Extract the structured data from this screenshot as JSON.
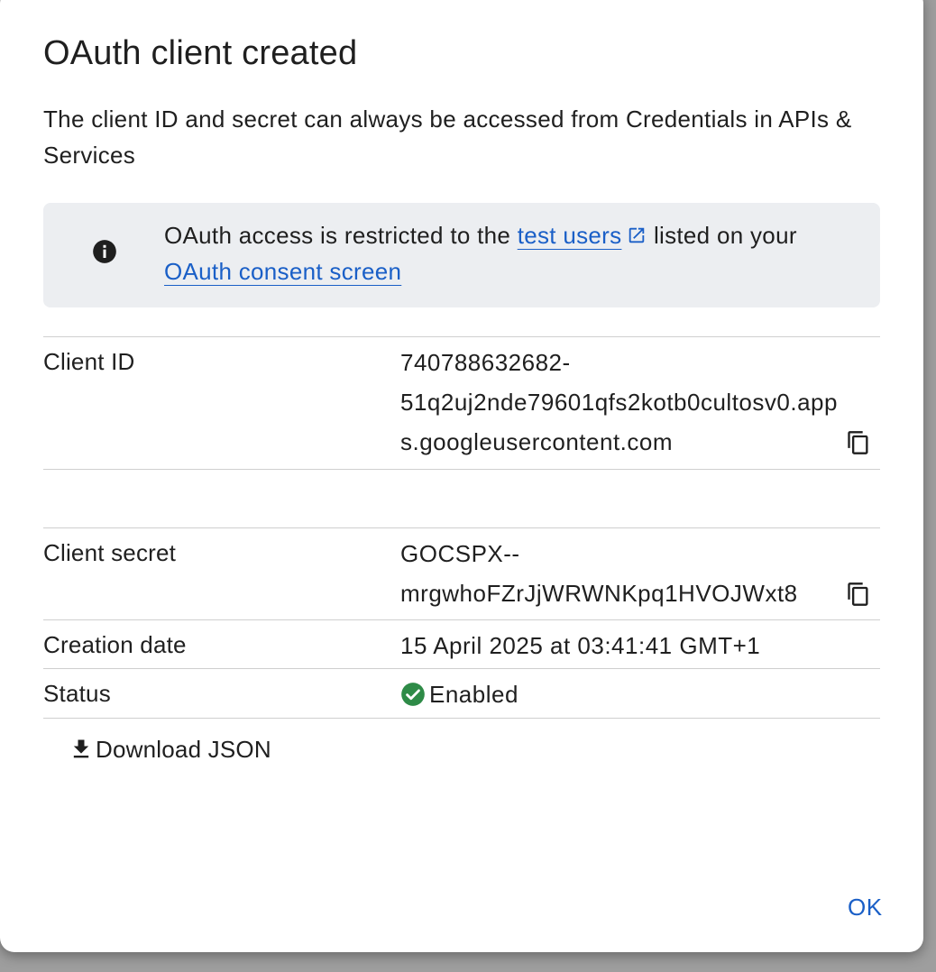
{
  "dialog": {
    "title": "OAuth client created",
    "subtitle": "The client ID and secret can always be accessed from Credentials in APIs & Services"
  },
  "banner": {
    "icon": "info-icon",
    "text_before": "OAuth access is restricted to the ",
    "test_users_link": "test users",
    "text_middle": " listed on your ",
    "consent_link": "OAuth consent screen"
  },
  "details": {
    "client_id": {
      "label": "Client ID",
      "value": "740788632682-51q2uj2nde79601qfs2kotb0cultosv0.apps.googleusercontent.com",
      "line1": "740788632682-",
      "line2": "51q2uj2nde79601qfs2kotb0cultosv0.app",
      "line3": "s.googleusercontent.com"
    },
    "client_secret": {
      "label": "Client secret",
      "value": "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",
      "line1": "GOCSPX--",
      "line2": "mrgwhoFZrJjWRWNKpq1HVOJWxt8"
    },
    "creation_date": {
      "label": "Creation date",
      "value": "15 April 2025 at 03:41:41 GMT+1"
    },
    "status": {
      "label": "Status",
      "value": "Enabled"
    }
  },
  "actions": {
    "download_label": "Download JSON",
    "ok_label": "OK"
  },
  "colors": {
    "link": "#1a5fc7",
    "banner_bg": "#eceef1",
    "status_enabled": "#2e8b47",
    "divider": "#cfcfcf"
  }
}
